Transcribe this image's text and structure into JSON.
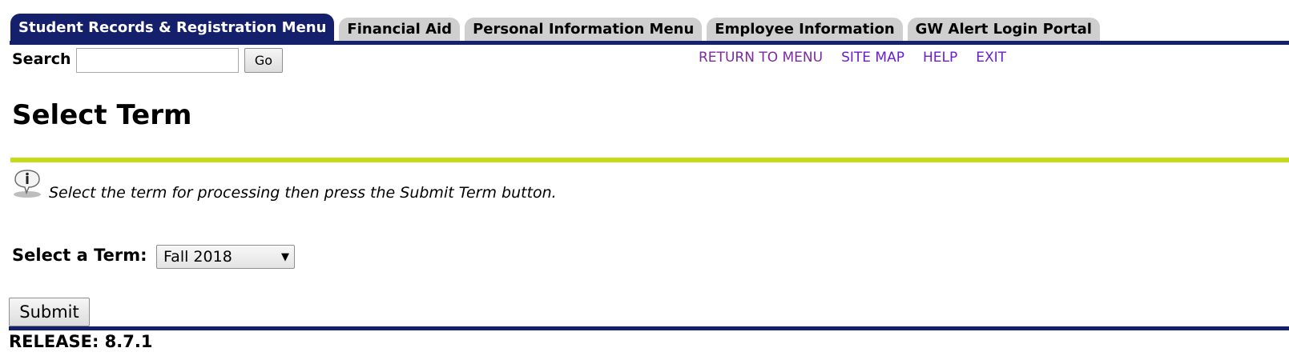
{
  "tabs": [
    {
      "label": "Student Records & Registration Menu",
      "active": true
    },
    {
      "label": "Financial Aid",
      "active": false
    },
    {
      "label": "Personal Information Menu",
      "active": false
    },
    {
      "label": "Employee Information",
      "active": false
    },
    {
      "label": "GW Alert Login Portal",
      "active": false
    }
  ],
  "search": {
    "label": "Search",
    "value": "",
    "placeholder": "",
    "go_label": "Go"
  },
  "top_links": [
    "RETURN TO MENU",
    "SITE MAP",
    "HELP",
    "EXIT"
  ],
  "page_title": "Select Term",
  "info": {
    "icon": "info-icon",
    "text": "Select the term for processing then press the Submit Term button."
  },
  "term": {
    "label": "Select a Term:",
    "selected": "Fall 2018"
  },
  "submit_label": "Submit",
  "release": "RELEASE: 8.7.1",
  "colors": {
    "nav_blue": "#14206b",
    "accent_green": "#c6dc16",
    "tab_gray": "#cfcfcf",
    "link_purple": "#6a1ecc"
  }
}
